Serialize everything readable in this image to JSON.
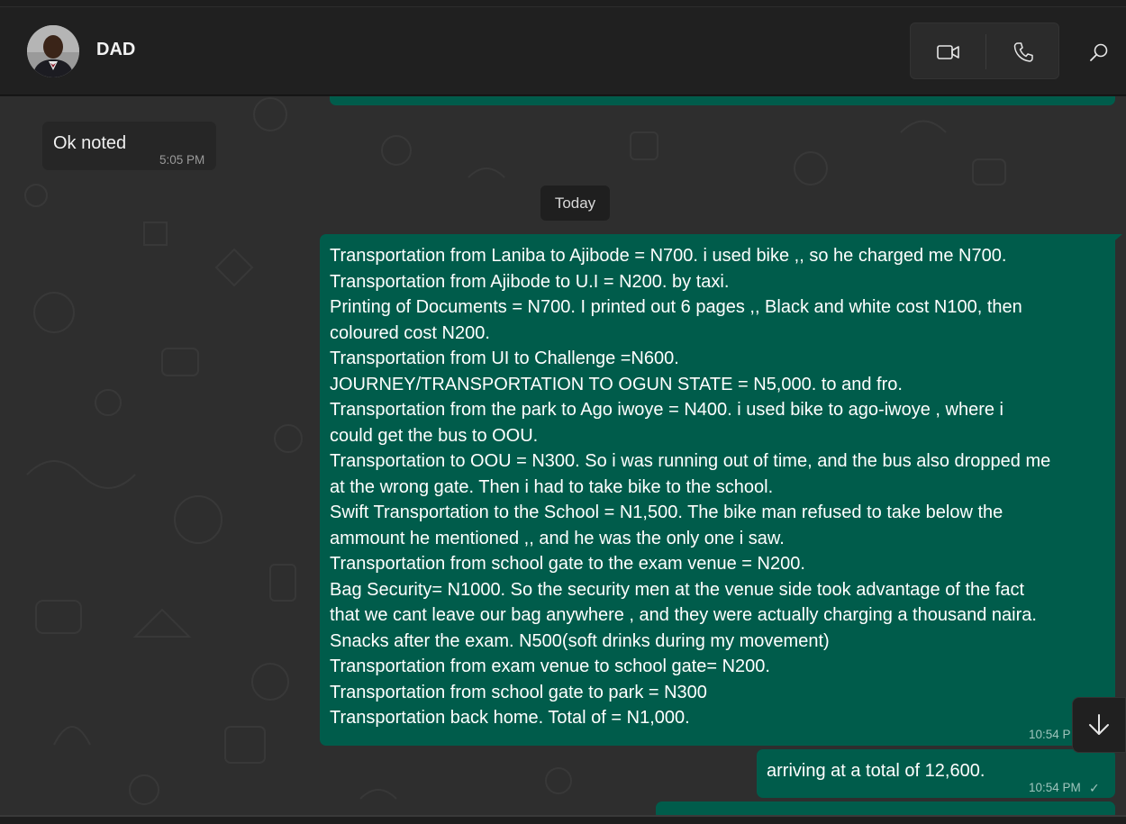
{
  "header": {
    "contact_name": "DAD",
    "avatar_icon": "contact-avatar",
    "video_call_icon": "video-camera-icon",
    "voice_call_icon": "phone-icon",
    "search_icon": "search-icon"
  },
  "colors": {
    "outgoing_bubble": "#005c4b",
    "incoming_bubble": "#262626",
    "chat_background": "#2e2e2e",
    "header_background": "#202020"
  },
  "messages": [
    {
      "direction": "incoming",
      "text": "Ok noted",
      "time": "5:05 PM"
    },
    {
      "direction": "outgoing",
      "lines": [
        "Transportation from Laniba to Ajibode = N700. i used bike ,, so he charged me N700.",
        "Transportation from Ajibode to U.I = N200. by taxi.",
        "Printing of Documents = N700. I printed out 6 pages ,, Black and white cost N100, then",
        "coloured cost N200.",
        "Transportation from UI to Challenge =N600.",
        "JOURNEY/TRANSPORTATION TO OGUN STATE = N5,000.  to and fro.",
        "Transportation from the park to Ago iwoye = N400. i used bike to ago-iwoye , where i",
        "could get the bus to OOU.",
        "Transportation to OOU = N300. So i was running out of time, and the bus also dropped me",
        "at the wrong gate. Then i had to take bike to the school.",
        "Swift Transportation to the School = N1,500. The bike man refused to take below the",
        "ammount he mentioned ,, and he was the only one i saw.",
        "Transportation from school gate to the exam venue = N200.",
        "Bag Security= N1000. So the security men at the venue side took advantage of the fact",
        "that we cant leave our bag anywhere , and they were actually charging a thousand naira.",
        "Snacks after the exam. N500(soft drinks during my movement)",
        "Transportation from exam venue to school gate= N200.",
        "Transportation from school gate to park = N300",
        "Transportation back home. Total of = N1,000."
      ],
      "time": "10:54 P"
    },
    {
      "direction": "outgoing",
      "text": "arriving at a total of 12,600.",
      "time": "10:54 PM",
      "status_icon": "single-check-icon"
    }
  ],
  "date_divider": "Today",
  "scroll_button_icon": "arrow-down-icon"
}
